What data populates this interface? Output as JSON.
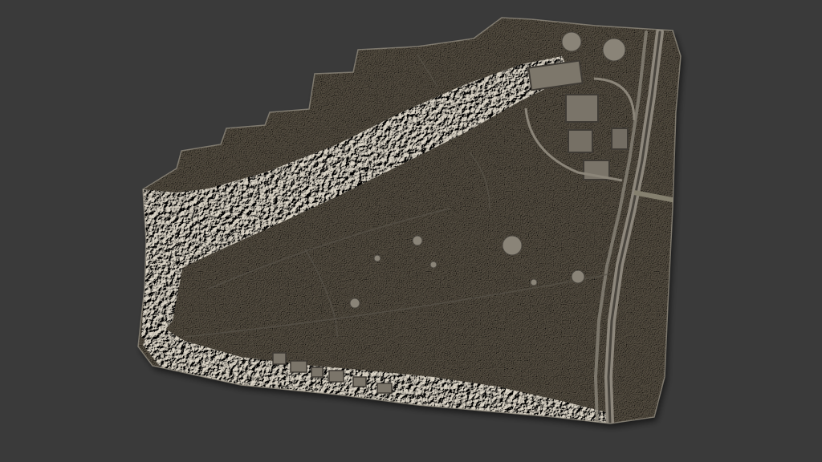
{
  "viewer": {
    "background_color": "#3a3a3a",
    "model_base_color": "#6f6a62",
    "model_shadow_color": "#4c4841",
    "model_highlight_color": "#a9a398",
    "model": "shaded-relief-terrain",
    "features": [
      "tree-belt",
      "open-field",
      "road",
      "buildings",
      "hedgerow",
      "footpaths"
    ]
  }
}
